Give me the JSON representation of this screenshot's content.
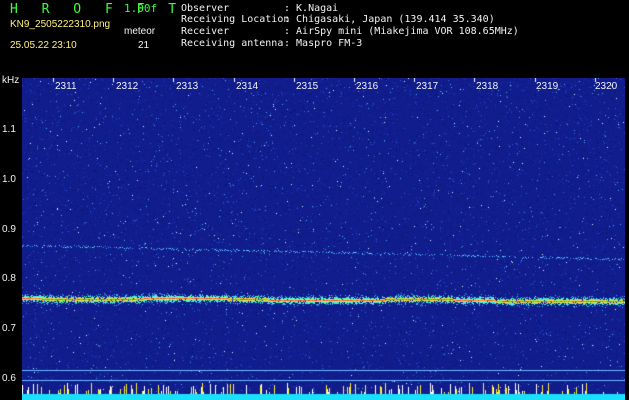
{
  "header": {
    "brand": "H R O F F T",
    "version": "1.00f",
    "filename": "KN9_2505222310.png",
    "meteor_label": "meteor",
    "datetime": "25.05.22 23:10",
    "meteor_count": "21"
  },
  "meta": [
    {
      "label": "Observer",
      "value": ": K.Nagai"
    },
    {
      "label": "Receiving Location",
      "value": ": Chigasaki, Japan (139.414 35.340)"
    },
    {
      "label": "Receiver",
      "value": ": AirSpy mini (Miakejima VOR 108.65MHz)"
    },
    {
      "label": "Receiving antenna",
      "value": ": Maspro FM-3"
    }
  ],
  "axis": {
    "y_unit": "kHz",
    "y_ticks": [
      "1.1",
      "1.0",
      "0.9",
      "0.8",
      "0.7",
      "0.6"
    ],
    "x_ticks": [
      "2311",
      "2312",
      "2313",
      "2314",
      "2315",
      "2316",
      "2317",
      "2318",
      "2319",
      "2320"
    ]
  },
  "colors": {
    "background": "#000000",
    "spectrogram": "#111d8c",
    "carrier": "#e8463a",
    "label_green": "#3cff3c",
    "label_yellow": "#fff27a"
  }
}
